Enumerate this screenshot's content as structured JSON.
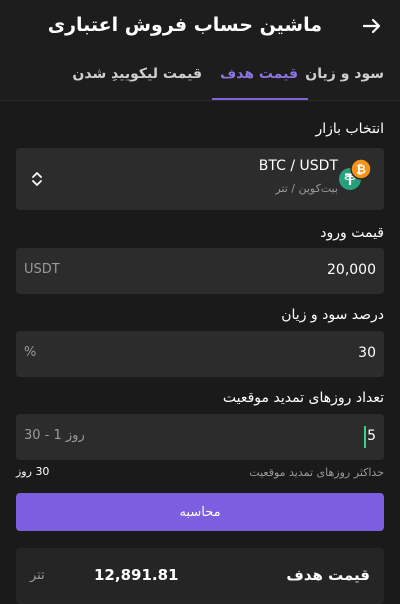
{
  "header": {
    "title": "ماشین حساب فروش اعتباری",
    "back_icon": "arrow-right-icon"
  },
  "tabs": [
    {
      "label": "سود و زیان",
      "active": false
    },
    {
      "label": "قیمت هدف",
      "active": true
    },
    {
      "label": "قیمت لیکوییدِ شدن",
      "active": false
    }
  ],
  "market": {
    "label": "انتخاب بازار",
    "pair": "BTC / USDT",
    "pair_sub": "بیت‌کوین / تتر",
    "icons": [
      "bitcoin-icon",
      "tether-icon"
    ]
  },
  "entry": {
    "label": "قیمت ورود",
    "value": "20,000",
    "unit": "USDT"
  },
  "pnl": {
    "label": "درصد سود و زیان",
    "value": "30",
    "unit": "%"
  },
  "days": {
    "label": "تعداد روزهای تمدید موقعیت",
    "value": "5",
    "placeholder": "روز 1 - 30",
    "note": "حداکثر روزهای تمدید موقعیت",
    "max": "30 روز"
  },
  "calc_button": "محاسبه",
  "result": {
    "label": "قیمت هدف",
    "value": "12,891.81",
    "unit": "تتر"
  },
  "colors": {
    "accent": "#7b5fe0",
    "tab_active": "#8d74e0",
    "bitcoin": "#f7931a",
    "tether": "#26a17b"
  }
}
